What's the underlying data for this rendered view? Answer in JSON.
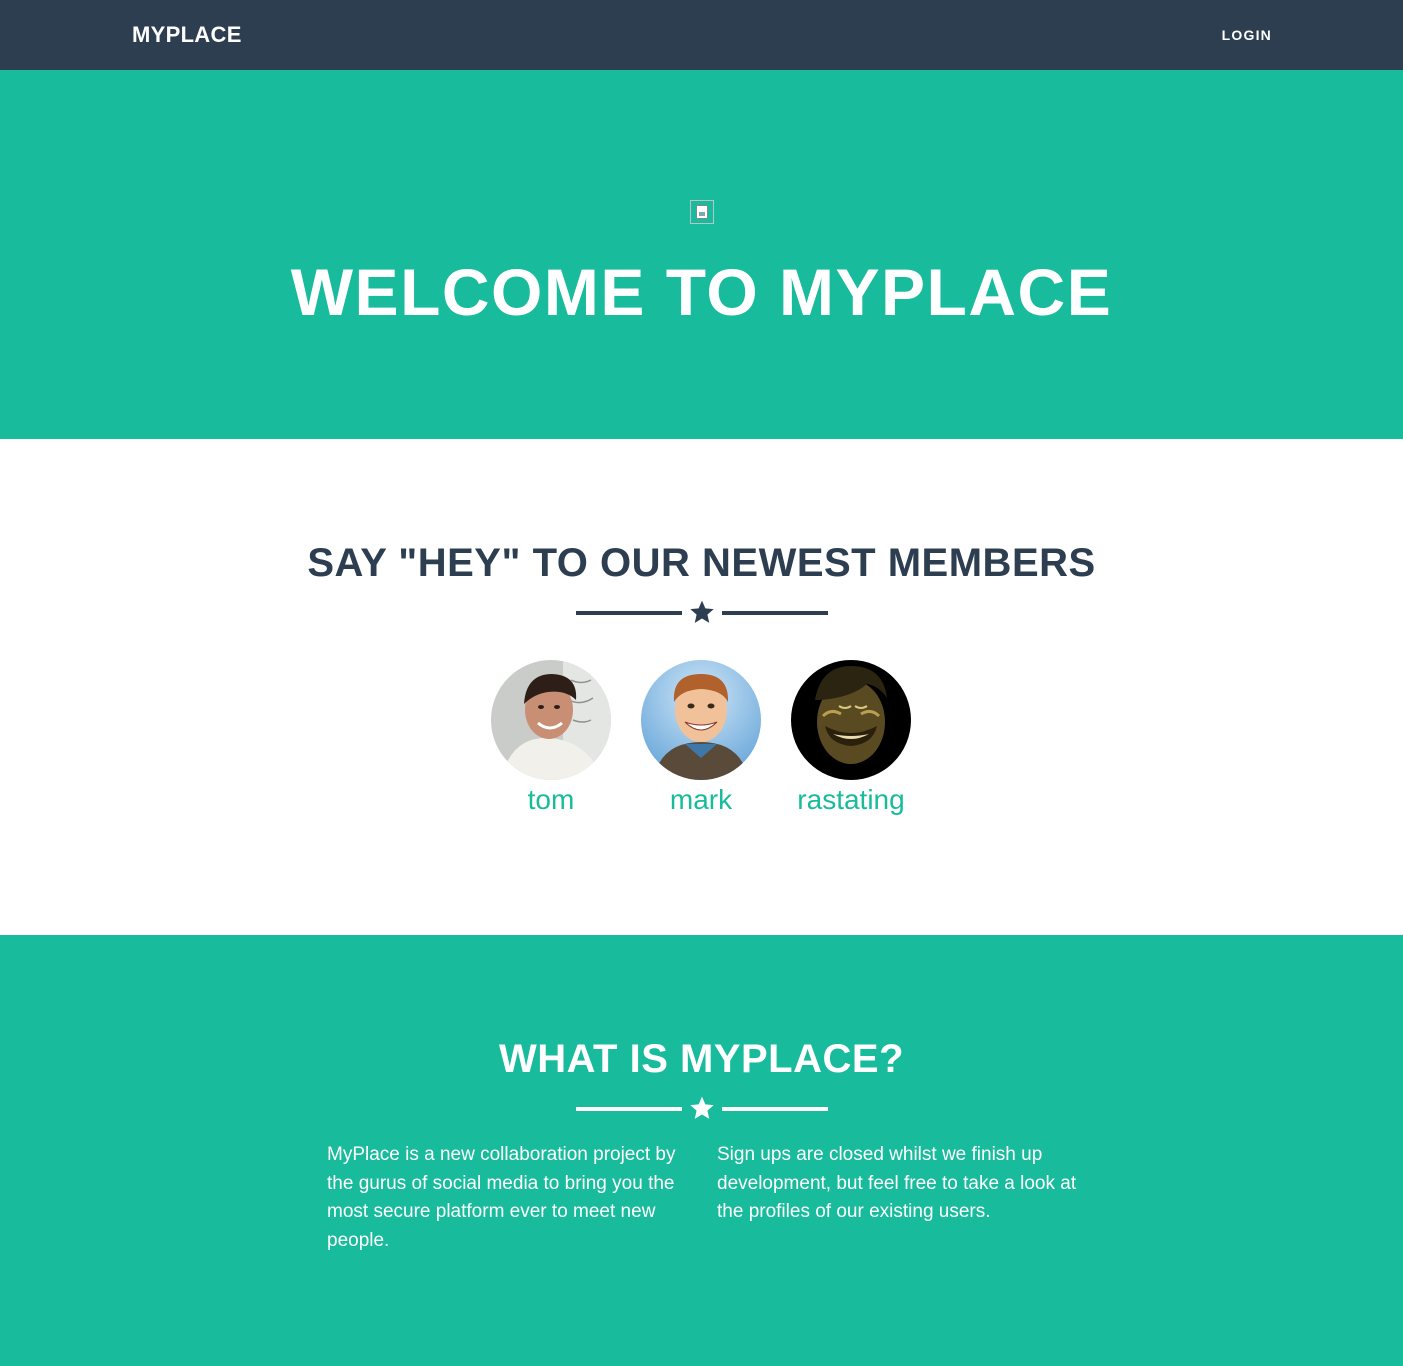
{
  "navbar": {
    "brand": "MYPLACE",
    "login_label": "LOGIN"
  },
  "masthead": {
    "image_icon": "broken-image-icon",
    "title": "WELCOME TO MYPLACE"
  },
  "members_section": {
    "title": "SAY \"HEY\" TO OUR NEWEST MEMBERS",
    "divider_icon": "star-icon",
    "members": [
      {
        "name": "tom"
      },
      {
        "name": "mark"
      },
      {
        "name": "rastating"
      }
    ]
  },
  "about_section": {
    "title": "WHAT IS MYPLACE?",
    "divider_icon": "star-icon",
    "left_text": "MyPlace is a new collaboration project by the gurus of social media to bring you the most secure platform ever to meet new people.",
    "right_text": "Sign ups are closed whilst we finish up development, but feel free to take a look at the profiles of our existing users."
  },
  "colors": {
    "primary": "#2c3e50",
    "accent": "#18bc9c",
    "white": "#ffffff"
  }
}
